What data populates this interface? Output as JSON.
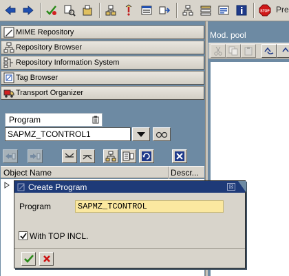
{
  "toolbar": {
    "label": "Pre",
    "icons": [
      "back-arrow-icon",
      "forward-arrow-icon",
      "check-syntax-icon",
      "where-used-icon",
      "display-object-list-icon",
      "hierarchy-up-icon",
      "activate-icon",
      "test-icon",
      "navigate-icon",
      "layout-icon",
      "menu-painter-icon",
      "screen-icon",
      "info-icon",
      "stop-icon"
    ]
  },
  "navigator": {
    "items": [
      {
        "label": "MIME Repository"
      },
      {
        "label": "Repository Browser"
      },
      {
        "label": "Repository Information System"
      },
      {
        "label": "Tag Browser"
      },
      {
        "label": "Transport Organizer"
      }
    ]
  },
  "selection": {
    "type_label": "Program",
    "object_value": "SAPMZ_TCONTROL1"
  },
  "tree": {
    "columns": {
      "object_name": "Object Name",
      "description": "Descr..."
    }
  },
  "editor": {
    "title": "Mod. pool"
  },
  "dialog": {
    "title": "Create Program",
    "program_label": "Program",
    "program_value": "SAPMZ_TCONTROL",
    "checkbox_label": "With TOP INCL.",
    "checkbox_checked": true,
    "close_symbol": "⊠"
  },
  "colors": {
    "background": "#6d8aa3",
    "toolbar": "#d8d4cb",
    "dialog_title": "#1e3a78",
    "input_highlight": "#fbe8a0",
    "confirm_green": "#2a8a1a",
    "cancel_red": "#cc1010"
  }
}
